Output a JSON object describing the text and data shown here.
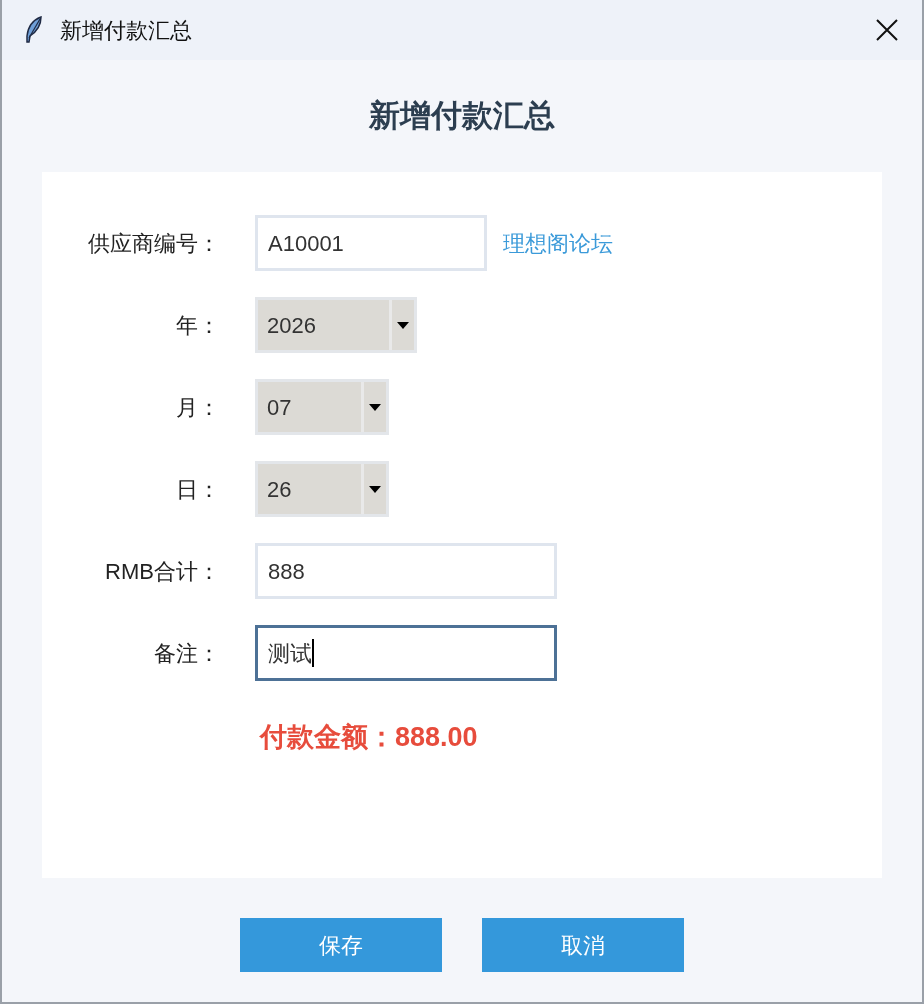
{
  "window": {
    "title": "新增付款汇总"
  },
  "heading": "新增付款汇总",
  "form": {
    "fields": [
      {
        "kind": "entry",
        "label": "供应商编号：",
        "value": "A10001",
        "focused": false,
        "link": "理想阁论坛"
      },
      {
        "kind": "combo",
        "label": "年：",
        "value": "2026"
      },
      {
        "kind": "combo",
        "label": "月：",
        "value": "07"
      },
      {
        "kind": "combo",
        "label": "日：",
        "value": "26"
      },
      {
        "kind": "entry",
        "label": "RMB合计：",
        "value": "888",
        "focused": false
      },
      {
        "kind": "entry",
        "label": "备注：",
        "value": "测试",
        "focused": true
      }
    ]
  },
  "total": {
    "label": "付款金额：",
    "value": "888.00"
  },
  "buttons": [
    {
      "label": "保存"
    },
    {
      "label": "取消"
    }
  ]
}
